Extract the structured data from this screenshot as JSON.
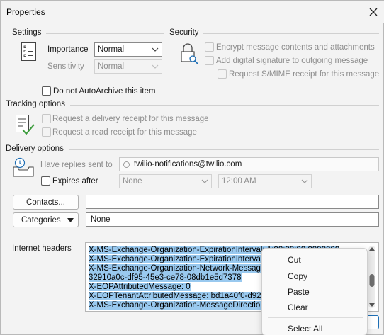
{
  "window": {
    "title": "Properties"
  },
  "settings": {
    "heading": "Settings",
    "importance_label": "Importance",
    "importance_value": "Normal",
    "sensitivity_label": "Sensitivity",
    "sensitivity_value": "Normal",
    "autoarchive_label": "Do not AutoArchive this item"
  },
  "security": {
    "heading": "Security",
    "encrypt_label": "Encrypt message contents and attachments",
    "signature_label": "Add digital signature to outgoing message",
    "smime_label": "Request S/MIME receipt for this message"
  },
  "tracking": {
    "heading": "Tracking options",
    "delivery_receipt_label": "Request a delivery receipt for this message",
    "read_receipt_label": "Request a read receipt for this message"
  },
  "delivery": {
    "heading": "Delivery options",
    "replies_label": "Have replies sent to",
    "replies_value": "twilio-notifications@twilio.com",
    "expires_label": "Expires after",
    "expires_date": "None",
    "expires_time": "12:00 AM"
  },
  "contacts_button": "Contacts...",
  "categories_button": "Categories",
  "categories_value": "None",
  "internet_headers": {
    "label": "Internet headers",
    "lines": [
      "X-MS-Exchange-Organization-ExpirationInterval: 1:00:00:00.0000000",
      "X-MS-Exchange-Organization-ExpirationInterva",
      "X-MS-Exchange-Organization-Network-Messag",
      "32910a0c-df95-45e3-ce78-08db1e5d7378",
      "X-EOPAttributedMessage: 0",
      "X-EOPTenantAttributedMessage: bd1a40f0-d92",
      "X-MS-Exchange-Organization-MessageDirection"
    ]
  },
  "context_menu": {
    "items": [
      "Cut",
      "Copy",
      "Paste",
      "Clear",
      "Select All"
    ]
  },
  "colors": {
    "selection": "#99c9ef",
    "dialog_bg": "#f3f3f3",
    "disabled_text": "#8d8d8d"
  }
}
